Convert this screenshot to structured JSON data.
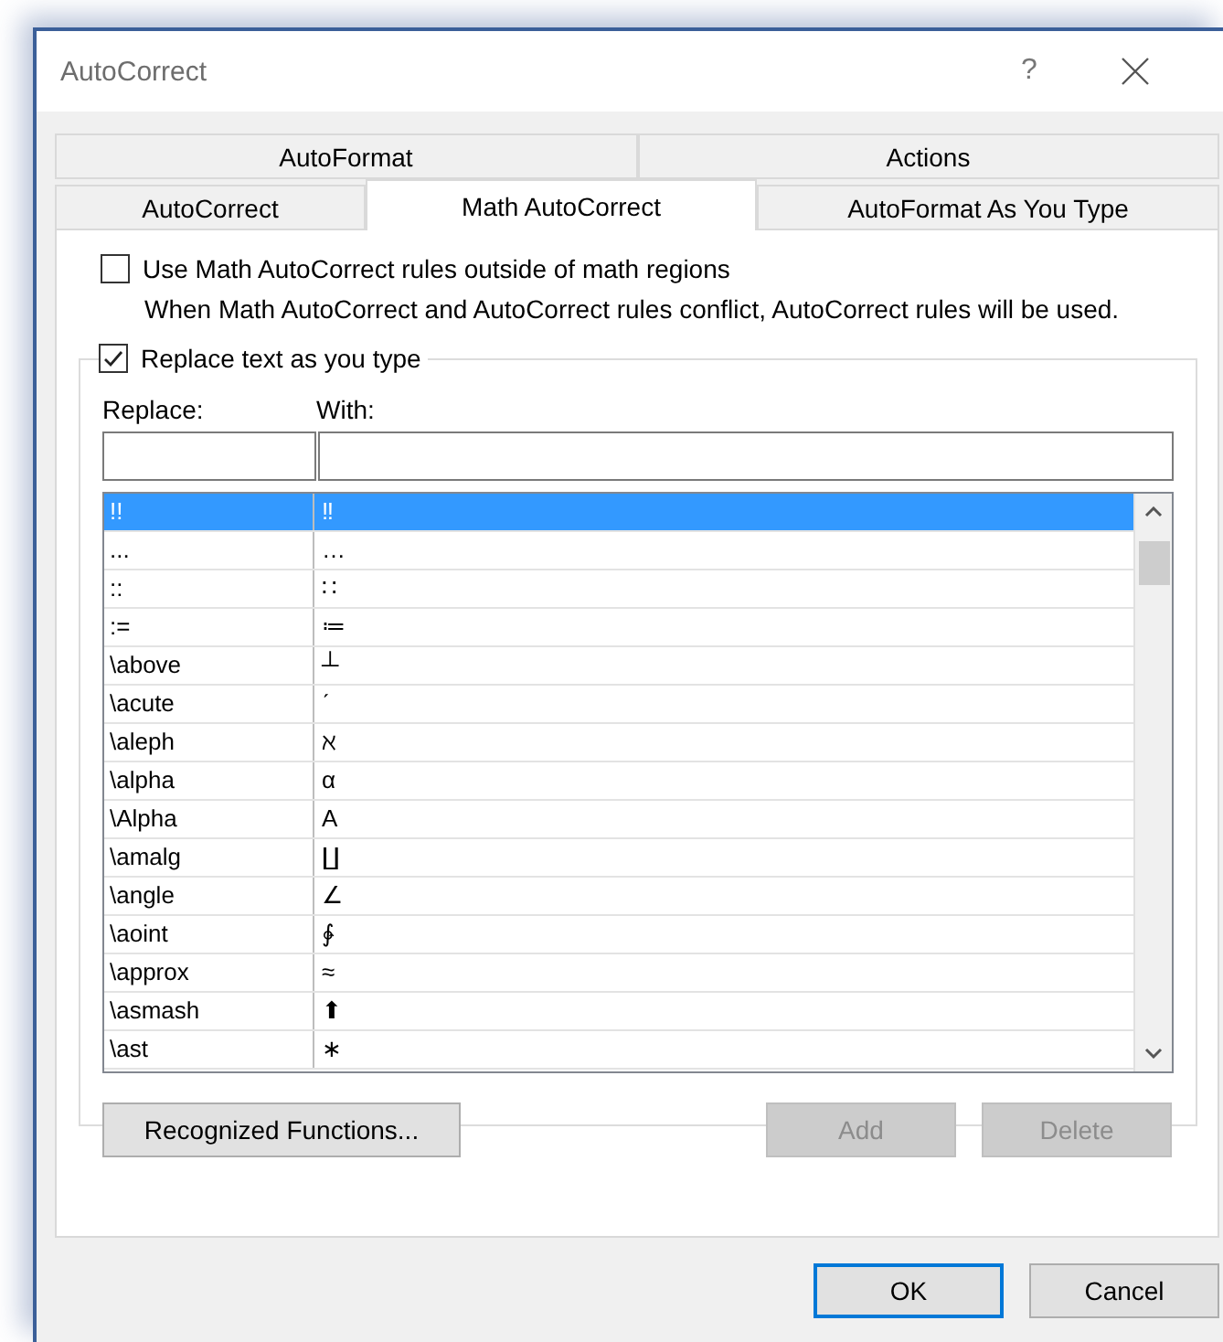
{
  "window": {
    "title": "AutoCorrect",
    "help": "?"
  },
  "tab_rows": [
    {
      "tabs": [
        {
          "label": "AutoFormat",
          "selected": false
        },
        {
          "label": "Actions",
          "selected": false
        }
      ]
    },
    {
      "tabs": [
        {
          "label": "AutoCorrect",
          "selected": false
        },
        {
          "label": "Math AutoCorrect",
          "selected": true
        },
        {
          "label": "AutoFormat As You Type",
          "selected": false
        }
      ]
    }
  ],
  "outside_option": {
    "label": "Use Math AutoCorrect rules outside of math regions",
    "checked": false,
    "note": "When Math AutoCorrect and AutoCorrect rules conflict, AutoCorrect rules will be used."
  },
  "replace_group": {
    "label": "Replace text as you type",
    "checked": true,
    "replace_label": "Replace:",
    "with_label": "With:",
    "rows": [
      {
        "replace": "!!",
        "with": "‼",
        "selected": true
      },
      {
        "replace": "...",
        "with": "…",
        "selected": false
      },
      {
        "replace": "::",
        "with": "∷",
        "selected": false
      },
      {
        "replace": ":=",
        "with": "≔",
        "selected": false
      },
      {
        "replace": "\\above",
        "with": "┴",
        "selected": false
      },
      {
        "replace": "\\acute",
        "with": "ˊ",
        "selected": false
      },
      {
        "replace": "\\aleph",
        "with": "ℵ",
        "selected": false
      },
      {
        "replace": "\\alpha",
        "with": "α",
        "selected": false
      },
      {
        "replace": "\\Alpha",
        "with": "Α",
        "selected": false
      },
      {
        "replace": "\\amalg",
        "with": "∐",
        "selected": false
      },
      {
        "replace": "\\angle",
        "with": "∠",
        "selected": false
      },
      {
        "replace": "\\aoint",
        "with": "∳",
        "selected": false
      },
      {
        "replace": "\\approx",
        "with": "≈",
        "selected": false
      },
      {
        "replace": "\\asmash",
        "with": "⬆",
        "selected": false
      },
      {
        "replace": "\\ast",
        "with": "∗",
        "selected": false
      }
    ],
    "buttons": [
      {
        "label": "Recognized Functions...",
        "disabled": false
      },
      {
        "label": "Add",
        "disabled": true
      },
      {
        "label": "Delete",
        "disabled": true
      }
    ]
  },
  "dialog_buttons": [
    {
      "label": "OK",
      "default": true
    },
    {
      "label": "Cancel",
      "default": false
    }
  ]
}
